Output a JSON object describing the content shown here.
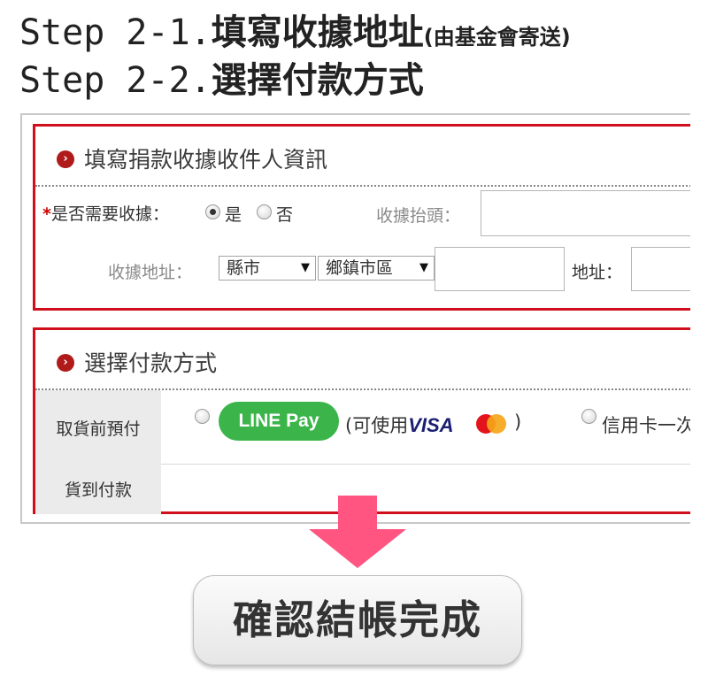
{
  "steps": [
    {
      "number": "Step 2-1.",
      "title": "填寫收據地址",
      "sub": "(由基金會寄送)"
    },
    {
      "number": "Step 2-2.",
      "title": "選擇付款方式"
    }
  ],
  "receipt": {
    "section_title": "填寫捐款收據收件人資訊",
    "required_mark": "*",
    "need_receipt_label": "是否需要收據：",
    "option_yes": "是",
    "option_no": "否",
    "selected": "是",
    "title_label": "收據抬頭：",
    "title_value": "",
    "address_label": "收據地址：",
    "county_select": "縣市",
    "district_select": "鄉鎮市區",
    "zip_value": "",
    "street_label": "地址：",
    "street_value": ""
  },
  "payment": {
    "section_title": "選擇付款方式",
    "row_prepay_label": "取貨前預付",
    "row_cod_label": "貨到付款",
    "linepay_text": "LINE Pay",
    "linepay_note_open": "(可使用",
    "visa_text": "VISA",
    "linepay_note_close": ")",
    "credit_card_label": "信用卡一次"
  },
  "confirm_button": "確認結帳完成",
  "colors": {
    "section_border": "#d10f1c",
    "linepay_green": "#3bb54a",
    "arrow_pink": "#ff5580",
    "visa_blue": "#1a1f71"
  },
  "icons": {
    "section_bullet": "chevron-right-circle-icon",
    "select_caret": "caret-down-icon",
    "arrow": "down-arrow-icon",
    "card_logo": "mastercard-logo-icon"
  }
}
